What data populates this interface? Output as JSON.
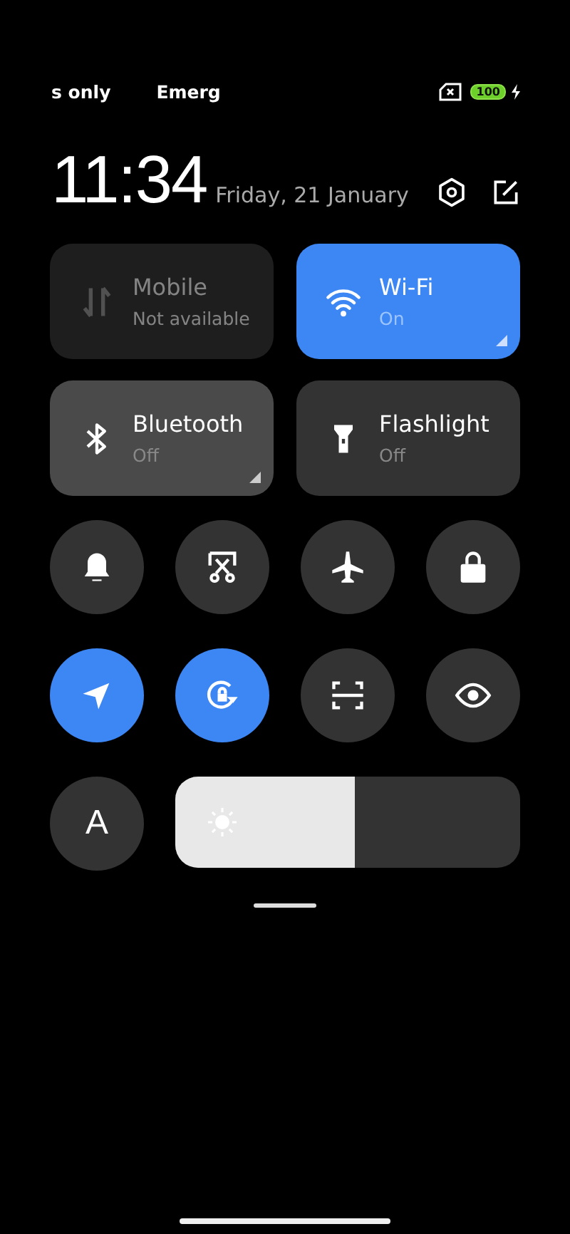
{
  "status_bar": {
    "carrier_texts": [
      "s only",
      "Emerg"
    ],
    "battery": "100",
    "charging": true
  },
  "header": {
    "time": "11:34",
    "date": "Friday, 21 January"
  },
  "tiles": [
    {
      "kind": "mobile",
      "label": "Mobile",
      "status": "Not available",
      "on": false,
      "disabled": true,
      "pressed": false,
      "expandable": false
    },
    {
      "kind": "wifi",
      "label": "Wi-Fi",
      "status": "On",
      "on": true,
      "disabled": false,
      "pressed": false,
      "expandable": true
    },
    {
      "kind": "bluetooth",
      "label": "Bluetooth",
      "status": "Off",
      "on": false,
      "disabled": false,
      "pressed": true,
      "expandable": true
    },
    {
      "kind": "flashlight",
      "label": "Flashlight",
      "status": "Off",
      "on": false,
      "disabled": false,
      "pressed": false,
      "expandable": false
    }
  ],
  "toggles": [
    {
      "kind": "bell",
      "on": false
    },
    {
      "kind": "scissors",
      "on": false
    },
    {
      "kind": "airplane",
      "on": false
    },
    {
      "kind": "lock",
      "on": false
    },
    {
      "kind": "location",
      "on": true
    },
    {
      "kind": "rotation",
      "on": true
    },
    {
      "kind": "scan",
      "on": false
    },
    {
      "kind": "eye",
      "on": false
    }
  ],
  "auto_brightness": {
    "label": "A",
    "on": false
  },
  "brightness": {
    "level": 0.52
  }
}
